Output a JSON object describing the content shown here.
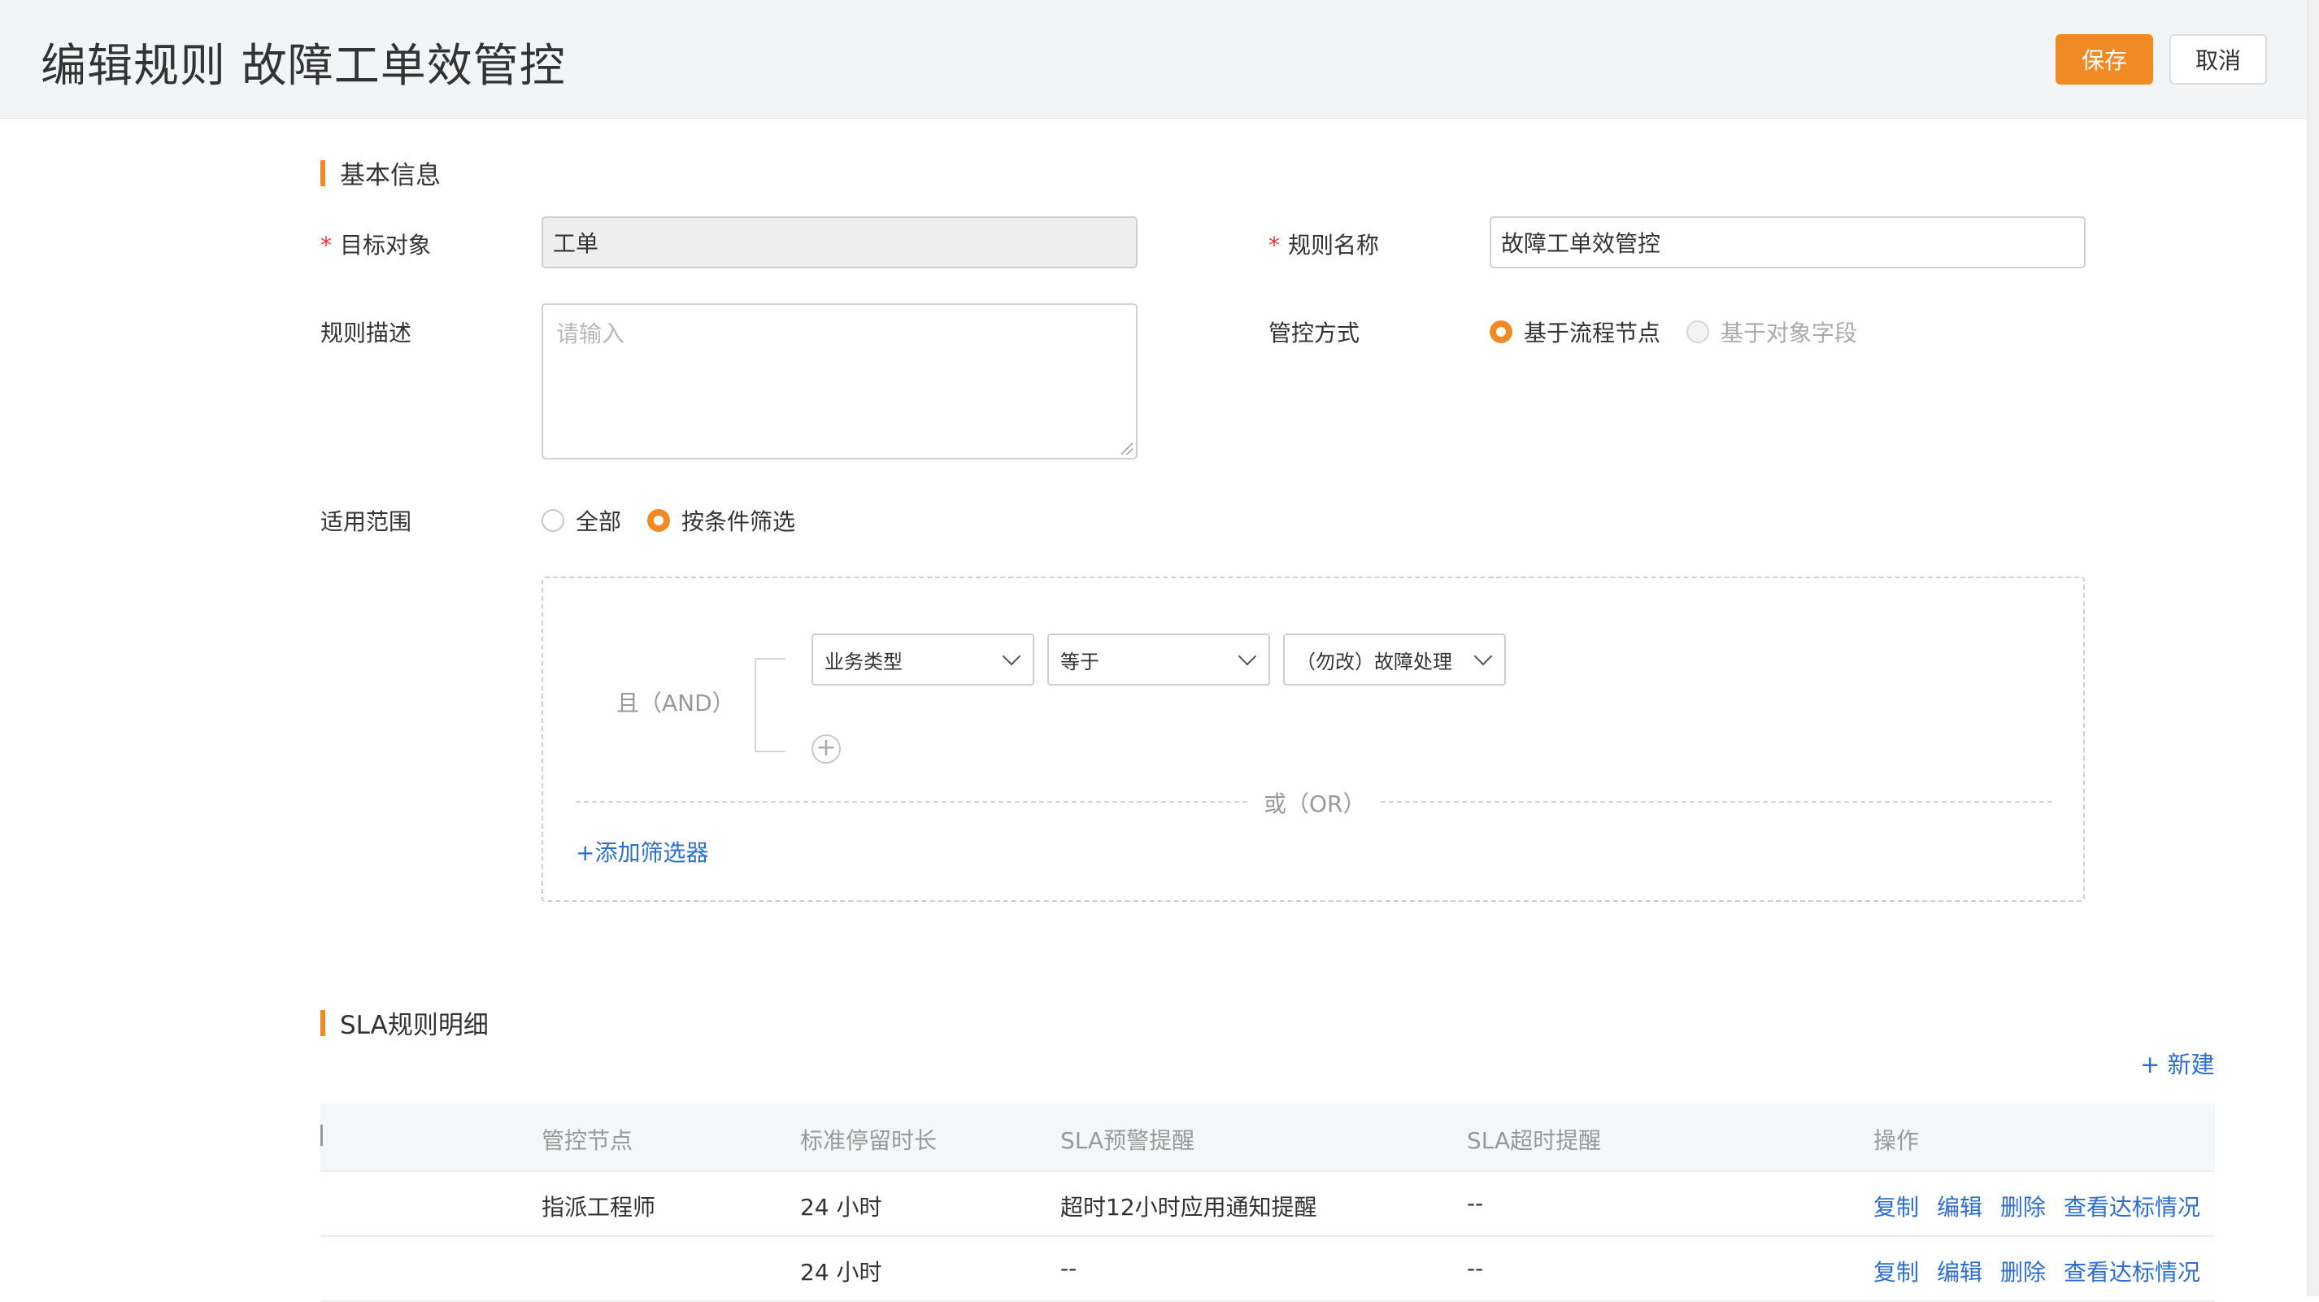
{
  "header": {
    "title": "编辑规则 故障工单效管控",
    "save_label": "保存",
    "cancel_label": "取消"
  },
  "basic_info": {
    "section_title": "基本信息",
    "target_object": {
      "required_mark": "*",
      "label": "目标对象",
      "value": "工单"
    },
    "rule_name": {
      "required_mark": "*",
      "label": "规则名称",
      "value": "故障工单效管控"
    },
    "rule_desc": {
      "label": "规则描述",
      "placeholder": "请输入"
    },
    "control_mode": {
      "label": "管控方式",
      "options": [
        {
          "label": "基于流程节点",
          "selected": true
        },
        {
          "label": "基于对象字段",
          "selected": false
        }
      ]
    },
    "scope": {
      "label": "适用范围",
      "options": [
        {
          "label": "全部",
          "selected": false
        },
        {
          "label": "按条件筛选",
          "selected": true
        }
      ]
    }
  },
  "filter": {
    "and_label": "且（AND）",
    "condition": {
      "field": "业务类型",
      "operator": "等于",
      "value": "（勿改）故障处理"
    },
    "or_label": "或（OR）",
    "add_filter_label": "+添加筛选器"
  },
  "sla": {
    "section_title": "SLA规则明细",
    "new_label": "+ 新建",
    "columns": [
      "管控节点",
      "标准停留时长",
      "SLA预警提醒",
      "SLA超时提醒",
      "操作"
    ],
    "rows": [
      {
        "node": "指派工程师",
        "duration": "24 小时",
        "warn": "超时12小时应用通知提醒",
        "timeout": "--"
      },
      {
        "node": "",
        "duration": "24 小时",
        "warn": "--",
        "timeout": "--"
      }
    ],
    "actions": [
      "复制",
      "编辑",
      "删除",
      "查看达标情况"
    ]
  },
  "colors": {
    "accent": "#f08a24",
    "link": "#2d6ecf",
    "required": "#e63c2e"
  }
}
